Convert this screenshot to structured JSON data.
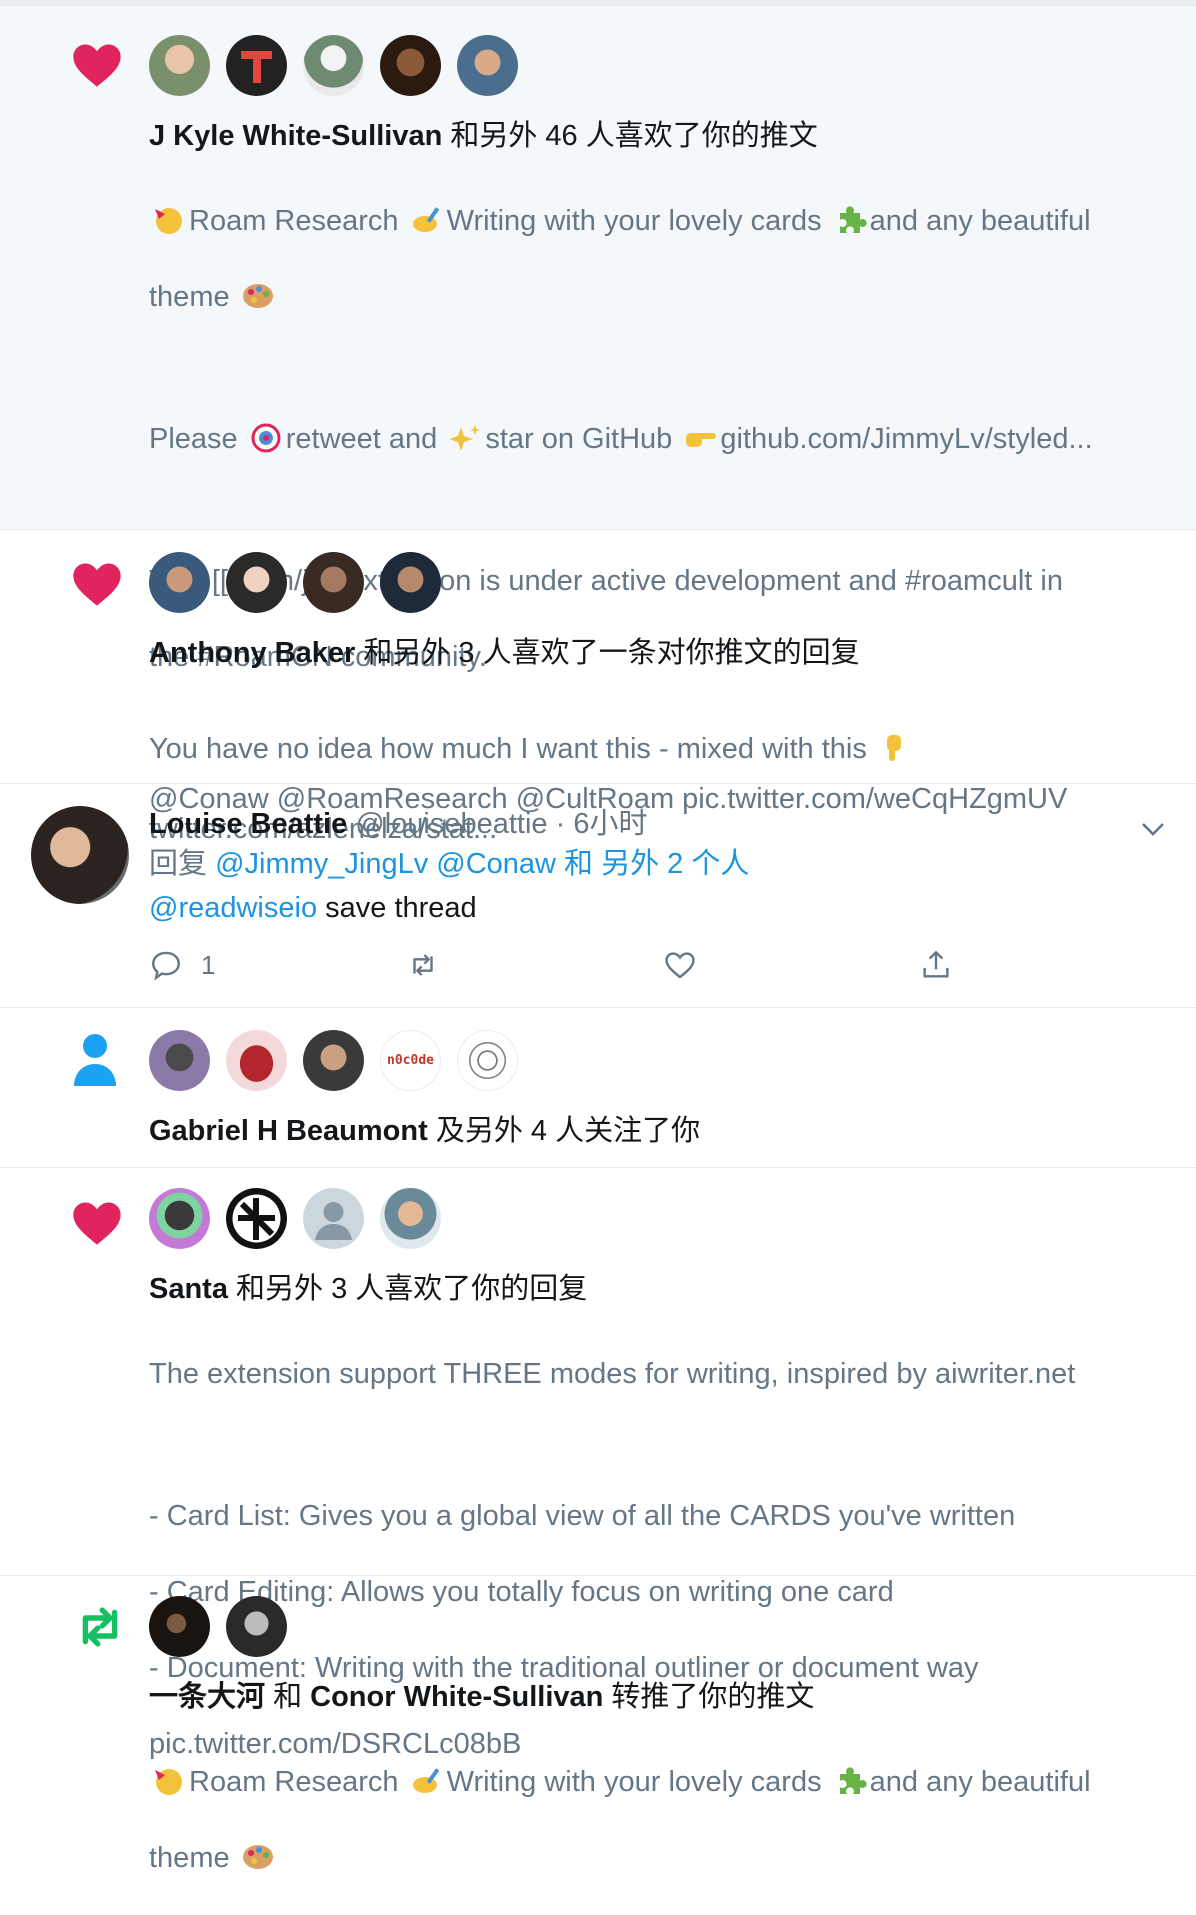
{
  "notifications": [
    {
      "type": "like",
      "icon": "heart-icon",
      "accent": "#e0245e",
      "avatars": [
        "avatar-1",
        "avatar-2",
        "avatar-3",
        "avatar-4",
        "avatar-5"
      ],
      "actor": "J Kyle White-Sullivan",
      "action": " 和另外 46 人喜欢了你的推文",
      "body": {
        "l1a": "Roam Research",
        "l1b": "Writing with your lovely cards",
        "l1c": "and any beautiful",
        "l2": "theme",
        "l3a": "Please",
        "l3b": "retweet and",
        "l3c": "star on GitHub",
        "l3d": "github.com/JimmyLv/styled...",
        "l4": "This [[roam/js]] extension is under active development and #roamcult in",
        "l5": "the #RoamCN community.",
        "l6": "@Conaw @RoamResearch @CultRoam pic.twitter.com/weCqHZgmUV"
      }
    },
    {
      "type": "like",
      "icon": "heart-icon",
      "actor": "Anthony Baker",
      "action": " 和另外 3 人喜欢了一条对你推文的回复",
      "body": {
        "l1": "You have no idea how much I want this - mixed with this",
        "l2": "twitter.com/azlenelza/stat..."
      }
    },
    {
      "type": "reply",
      "name": "Louise Beattie",
      "handle": "@louisebeattie",
      "dot": "·",
      "time": "6小时",
      "reply_prefix": "回复 ",
      "reply_to": "@Jimmy_JingLv @Conaw 和 另外 2 个人",
      "mention": "@readwiseio",
      "text": " save thread",
      "reply_count": "1"
    },
    {
      "type": "follow",
      "icon": "person-icon",
      "actor": "Gabriel H Beaumont",
      "action": " 及另外 4 人关注了你",
      "badge_text": "n0c0de"
    },
    {
      "type": "like",
      "icon": "heart-icon",
      "actor": "Santa",
      "action": " 和另外 3 人喜欢了你的回复",
      "body": {
        "l1": "The extension support THREE modes for writing, inspired by aiwriter.net",
        "l2": "- Card List: Gives you a global view of all the CARDS you've written",
        "l3": "- Card Editing: Allows you totally focus on writing one card",
        "l4": "- Document: Writing with the traditional outliner or document way",
        "l5": "pic.twitter.com/DSRCLc08bB"
      }
    },
    {
      "type": "retweet",
      "icon": "retweet-icon",
      "accent": "#17bf63",
      "actor": "一条大河",
      "mid": " 和 ",
      "actor2": "Conor White-Sullivan",
      "action": " 转推了你的推文",
      "body": {
        "l1a": "Roam Research",
        "l1b": "Writing with your lovely cards",
        "l1c": "and any beautiful",
        "l2": "theme"
      }
    }
  ]
}
